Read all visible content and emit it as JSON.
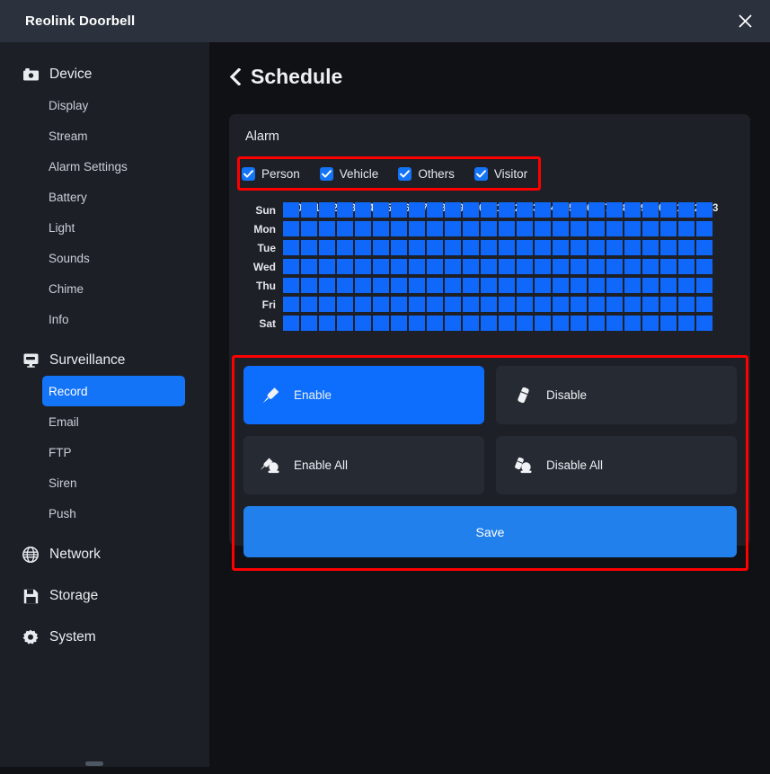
{
  "window": {
    "title": "Reolink Doorbell",
    "close_icon": "close-icon"
  },
  "sidebar": {
    "groups": [
      {
        "label": "Device",
        "icon": "camera-icon",
        "items": [
          "Display",
          "Stream",
          "Alarm Settings",
          "Battery",
          "Light",
          "Sounds",
          "Chime",
          "Info"
        ]
      },
      {
        "label": "Surveillance",
        "icon": "monitor-icon",
        "items": [
          "Record",
          "Email",
          "FTP",
          "Siren",
          "Push"
        ],
        "active_item": "Record"
      },
      {
        "label": "Network",
        "icon": "globe-icon",
        "items": []
      },
      {
        "label": "Storage",
        "icon": "floppy-disk-icon",
        "items": []
      },
      {
        "label": "System",
        "icon": "gear-icon",
        "items": []
      }
    ]
  },
  "page": {
    "back_icon": "chevron-left-icon",
    "title": "Schedule"
  },
  "alarm": {
    "card_title": "Alarm",
    "types": [
      {
        "label": "Person",
        "checked": true
      },
      {
        "label": "Vehicle",
        "checked": true
      },
      {
        "label": "Others",
        "checked": true
      },
      {
        "label": "Visitor",
        "checked": true
      }
    ]
  },
  "schedule": {
    "days": [
      "Sun",
      "Mon",
      "Tue",
      "Wed",
      "Thu",
      "Fri",
      "Sat"
    ],
    "hours": [
      "0",
      "1",
      "2",
      "3",
      "4",
      "5",
      "6",
      "7",
      "8",
      "9",
      "10",
      "11",
      "12",
      "13",
      "14",
      "15",
      "16",
      "17",
      "18",
      "19",
      "20",
      "21",
      "22",
      "23"
    ],
    "cell_color": "#1068fa",
    "all_enabled": true
  },
  "actions": {
    "buttons": [
      {
        "label": "Enable",
        "icon": "brush-icon",
        "active": true
      },
      {
        "label": "Disable",
        "icon": "eraser-icon",
        "active": false
      },
      {
        "label": "Enable All",
        "icon": "brush-all-icon",
        "active": false
      },
      {
        "label": "Disable All",
        "icon": "eraser-all-icon",
        "active": false
      }
    ],
    "save_label": "Save"
  },
  "annotations": {
    "color": "#fe0000",
    "boxes": [
      "alarm-types-row",
      "action-buttons-group"
    ]
  }
}
